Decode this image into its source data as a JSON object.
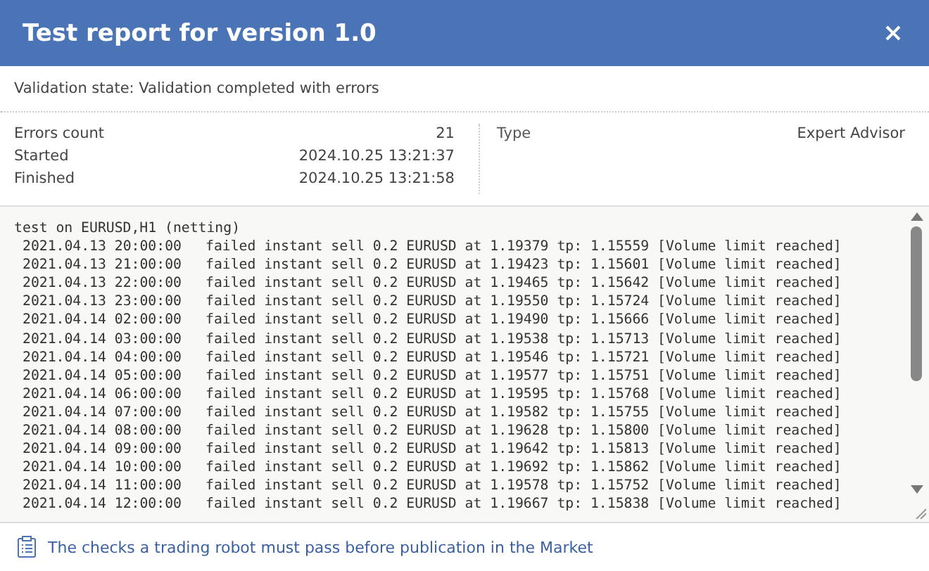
{
  "window": {
    "title": "Test report for version 1.0"
  },
  "validation_state": "Validation state: Validation completed with errors",
  "summary_left": [
    {
      "label": "Errors count",
      "value": "21"
    },
    {
      "label": "Started",
      "value": "2024.10.25 13:21:37"
    },
    {
      "label": "Finished",
      "value": "2024.10.25 13:21:58"
    }
  ],
  "summary_right": [
    {
      "label": "Type",
      "value": "Expert Advisor"
    }
  ],
  "log": {
    "heading": "test on EURUSD,H1 (netting)",
    "entries": [
      {
        "time": "2021.04.13 20:00:00",
        "message": "failed instant sell 0.2 EURUSD at 1.19379 tp: 1.15559 [Volume limit reached]"
      },
      {
        "time": "2021.04.13 21:00:00",
        "message": "failed instant sell 0.2 EURUSD at 1.19423 tp: 1.15601 [Volume limit reached]"
      },
      {
        "time": "2021.04.13 22:00:00",
        "message": "failed instant sell 0.2 EURUSD at 1.19465 tp: 1.15642 [Volume limit reached]"
      },
      {
        "time": "2021.04.13 23:00:00",
        "message": "failed instant sell 0.2 EURUSD at 1.19550 tp: 1.15724 [Volume limit reached]"
      },
      {
        "time": "2021.04.14 02:00:00",
        "message": "failed instant sell 0.2 EURUSD at 1.19490 tp: 1.15666 [Volume limit reached]"
      },
      {
        "time": "2021.04.14 03:00:00",
        "message": "failed instant sell 0.2 EURUSD at 1.19538 tp: 1.15713 [Volume limit reached]"
      },
      {
        "time": "2021.04.14 04:00:00",
        "message": "failed instant sell 0.2 EURUSD at 1.19546 tp: 1.15721 [Volume limit reached]"
      },
      {
        "time": "2021.04.14 05:00:00",
        "message": "failed instant sell 0.2 EURUSD at 1.19577 tp: 1.15751 [Volume limit reached]"
      },
      {
        "time": "2021.04.14 06:00:00",
        "message": "failed instant sell 0.2 EURUSD at 1.19595 tp: 1.15768 [Volume limit reached]"
      },
      {
        "time": "2021.04.14 07:00:00",
        "message": "failed instant sell 0.2 EURUSD at 1.19582 tp: 1.15755 [Volume limit reached]"
      },
      {
        "time": "2021.04.14 08:00:00",
        "message": "failed instant sell 0.2 EURUSD at 1.19628 tp: 1.15800 [Volume limit reached]"
      },
      {
        "time": "2021.04.14 09:00:00",
        "message": "failed instant sell 0.2 EURUSD at 1.19642 tp: 1.15813 [Volume limit reached]"
      },
      {
        "time": "2021.04.14 10:00:00",
        "message": "failed instant sell 0.2 EURUSD at 1.19692 tp: 1.15862 [Volume limit reached]"
      },
      {
        "time": "2021.04.14 11:00:00",
        "message": "failed instant sell 0.2 EURUSD at 1.19578 tp: 1.15752 [Volume limit reached]"
      },
      {
        "time": "2021.04.14 12:00:00",
        "message": "failed instant sell 0.2 EURUSD at 1.19667 tp: 1.15838 [Volume limit reached]"
      }
    ]
  },
  "footer_link": "The checks a trading robot must pass before publication in the Market"
}
